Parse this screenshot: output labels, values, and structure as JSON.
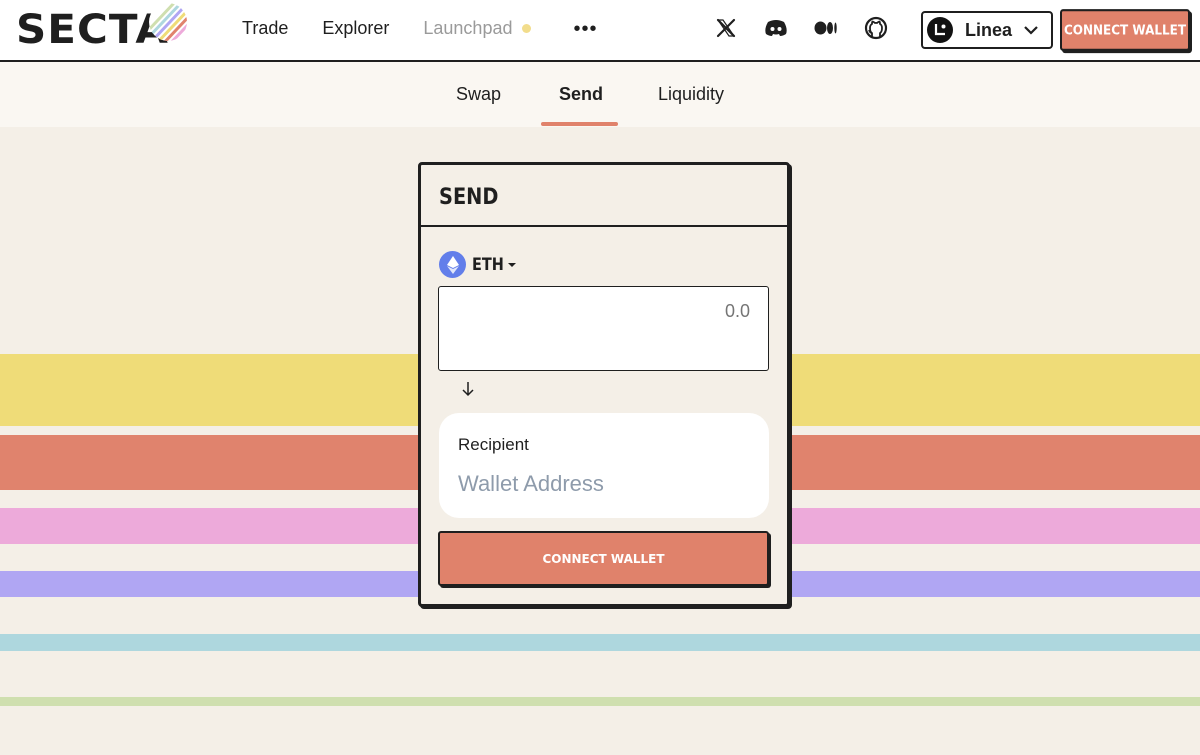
{
  "brand": {
    "name": "SECTA"
  },
  "nav": {
    "items": [
      {
        "label": "Trade"
      },
      {
        "label": "Explorer"
      },
      {
        "label": "Launchpad"
      }
    ],
    "more_icon": "ellipsis-icon"
  },
  "social": {
    "icons": [
      "x-icon",
      "discord-icon",
      "medium-icon",
      "github-icon"
    ]
  },
  "network": {
    "label": "Linea",
    "logo_letter": "L"
  },
  "header": {
    "connect_label": "CONNECT WALLET"
  },
  "tabs": [
    {
      "label": "Swap"
    },
    {
      "label": "Send",
      "active": true
    },
    {
      "label": "Liquidity"
    }
  ],
  "send": {
    "title": "SEND",
    "token": {
      "symbol": "ETH",
      "icon": "ethereum-icon"
    },
    "amount_placeholder": "0.0",
    "recipient_label": "Recipient",
    "recipient_placeholder": "Wallet Address",
    "connect_label": "CONNECT WALLET"
  },
  "colors": {
    "accent": "#e0826b",
    "background": "#f4efe7",
    "stripes": [
      "#efdc78",
      "#e0836d",
      "#edaada",
      "#b0a6f3",
      "#aed7de",
      "#cfdfaf"
    ]
  }
}
